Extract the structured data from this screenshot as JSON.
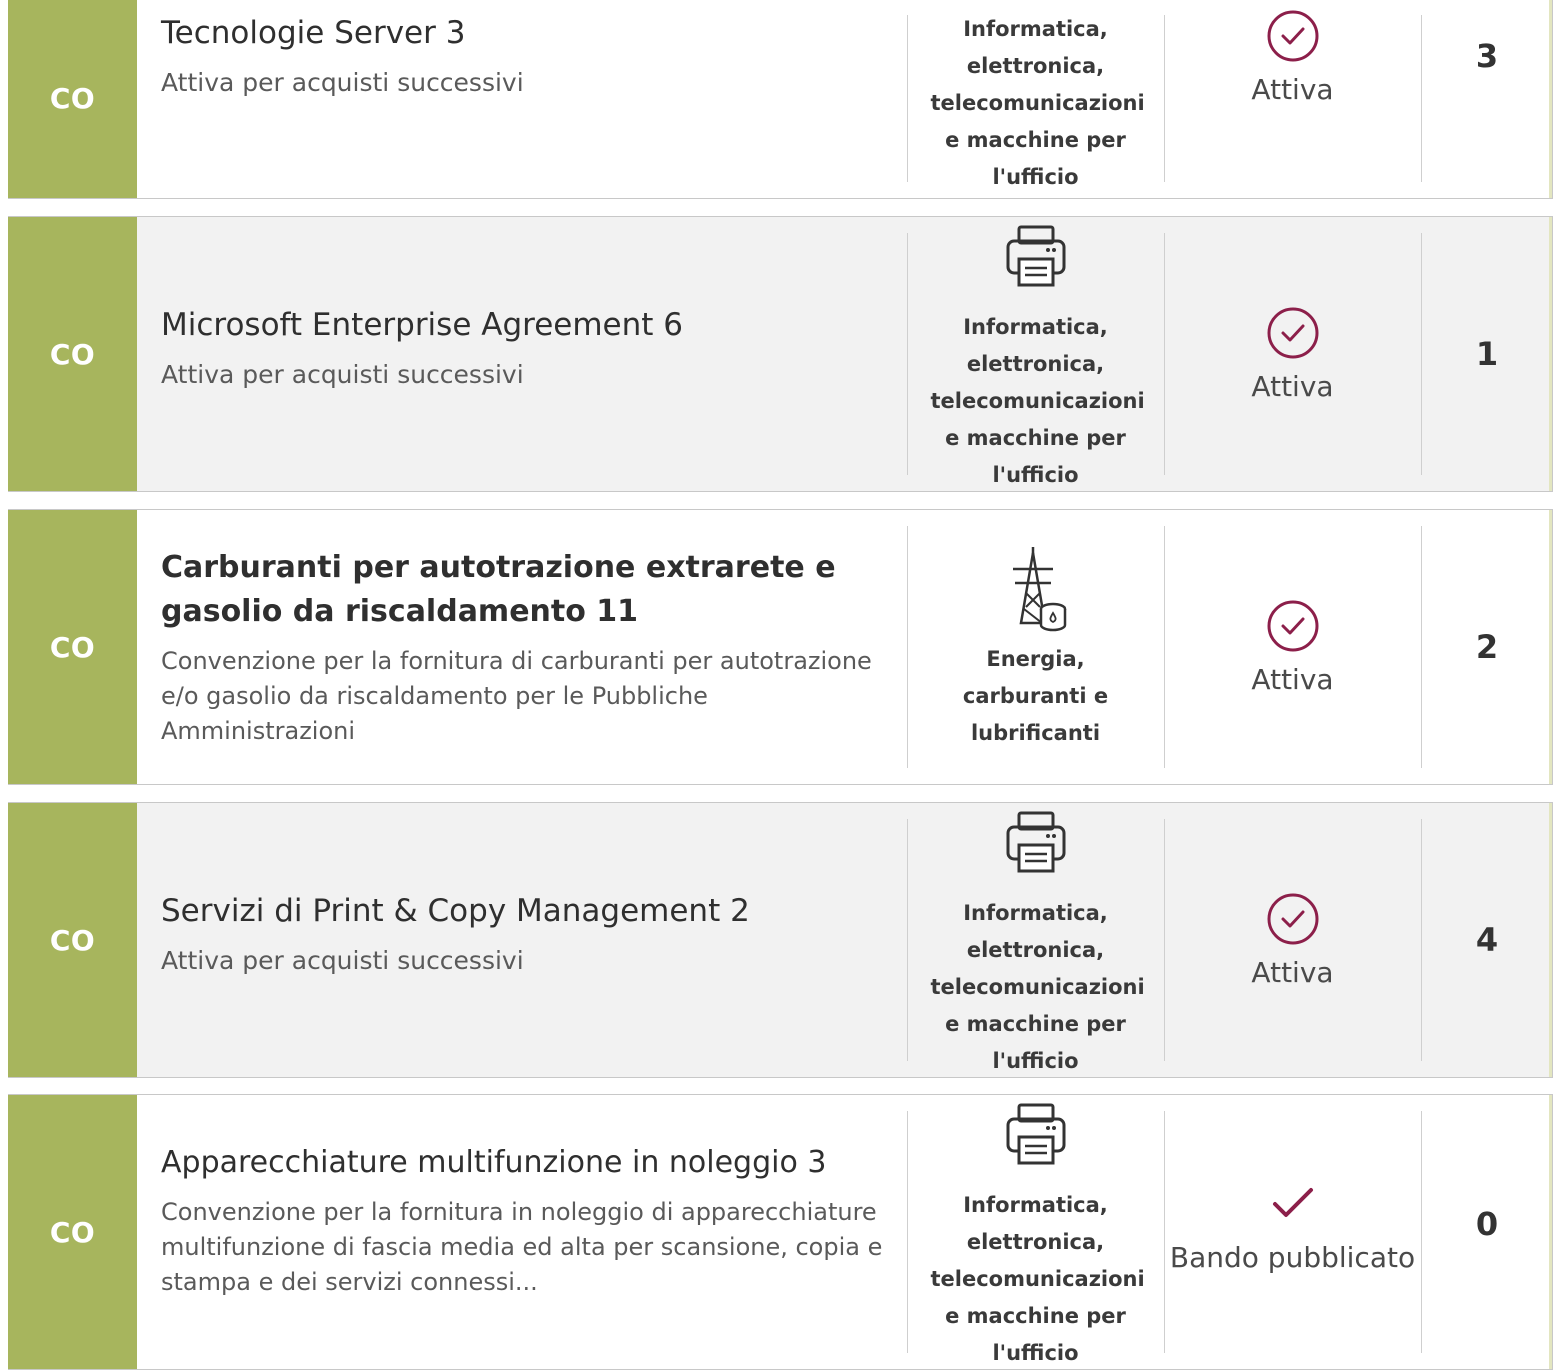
{
  "colors": {
    "badge": "#a7b55d",
    "status_icon": "#8c1f4a",
    "row_alt": "#f2f2f2"
  },
  "rows": [
    {
      "badge": "CO",
      "title": "Tecnologie Server 3",
      "description": "Attiva per acquisti successivi",
      "category": "Informatica, elettronica, telecomunicazioni e macchine per l'ufficio",
      "category_icon": "",
      "status": "Attiva",
      "status_icon": "check-circle-icon",
      "count": "3"
    },
    {
      "badge": "CO",
      "title": "Microsoft Enterprise Agreement 6",
      "description": "Attiva per acquisti successivi",
      "category": "Informatica, elettronica, telecomunicazioni e macchine per l'ufficio",
      "category_icon": "printer-icon",
      "status": "Attiva",
      "status_icon": "check-circle-icon",
      "count": "1"
    },
    {
      "badge": "CO",
      "title": "Carburanti per autotrazione extrarete e gasolio da riscaldamento 11",
      "description": "Convenzione per la fornitura di carburanti per autotrazione e/o gasolio da riscaldamento per le Pubbliche Amministrazioni",
      "category": "Energia, carburanti e lubrificanti",
      "category_icon": "energy-pylon-icon",
      "status": "Attiva",
      "status_icon": "check-circle-icon",
      "count": "2"
    },
    {
      "badge": "CO",
      "title": "Servizi di Print & Copy Management 2",
      "description": "Attiva per acquisti successivi",
      "category": "Informatica, elettronica, telecomunicazioni e macchine per l'ufficio",
      "category_icon": "printer-icon",
      "status": "Attiva",
      "status_icon": "check-circle-icon",
      "count": "4"
    },
    {
      "badge": "CO",
      "title": "Apparecchiature multifunzione in noleggio 3",
      "description": "Convenzione per la fornitura in noleggio di apparecchiature multifunzione di fascia media ed alta per scansione, copia e stampa e dei servizi connessi...",
      "category": "Informatica, elettronica, telecomunicazioni e macchine per l'ufficio",
      "category_icon": "printer-icon",
      "status": "Bando pubblicato",
      "status_icon": "check-icon",
      "count": "0"
    }
  ]
}
